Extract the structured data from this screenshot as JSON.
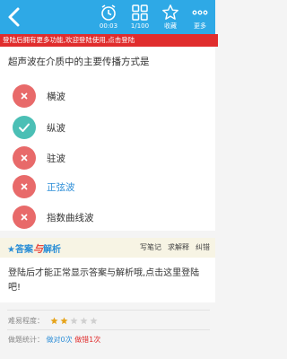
{
  "toolbar": {
    "timer": "00:03",
    "progress": "1/100",
    "favorite": "收藏",
    "more": "更多"
  },
  "banner": "登陆后拥有更多功能,欢迎登陆使用,点击登陆",
  "question": {
    "text": "超声波在介质中的主要传播方式是",
    "options": [
      {
        "label": "横波",
        "state": "wrong"
      },
      {
        "label": "纵波",
        "state": "correct"
      },
      {
        "label": "驻波",
        "state": "wrong"
      },
      {
        "label": "正弦波",
        "state": "selected"
      },
      {
        "label": "指数曲线波",
        "state": "wrong"
      }
    ]
  },
  "answer": {
    "title_left": "答案",
    "title_amp": "与",
    "title_right": "解析",
    "links": [
      "写笔记",
      "求解释",
      "纠错"
    ],
    "body": "登陆后才能正常显示答案与解析哦,点击这里登陆吧!"
  },
  "stats": {
    "difficulty_label": "难易程度：",
    "difficulty_stars": 2,
    "difficulty_max": 5,
    "count_label": "做题统计：",
    "right": "做对0次",
    "wrong": "做错1次"
  },
  "colors": {
    "topbar": "#2ea9e6",
    "banner": "#e02d2d",
    "wrong_circle": "#e86a6a",
    "correct_circle": "#4bbfb5",
    "star_on": "#e6a41c",
    "star_off": "#d0d0d0"
  }
}
